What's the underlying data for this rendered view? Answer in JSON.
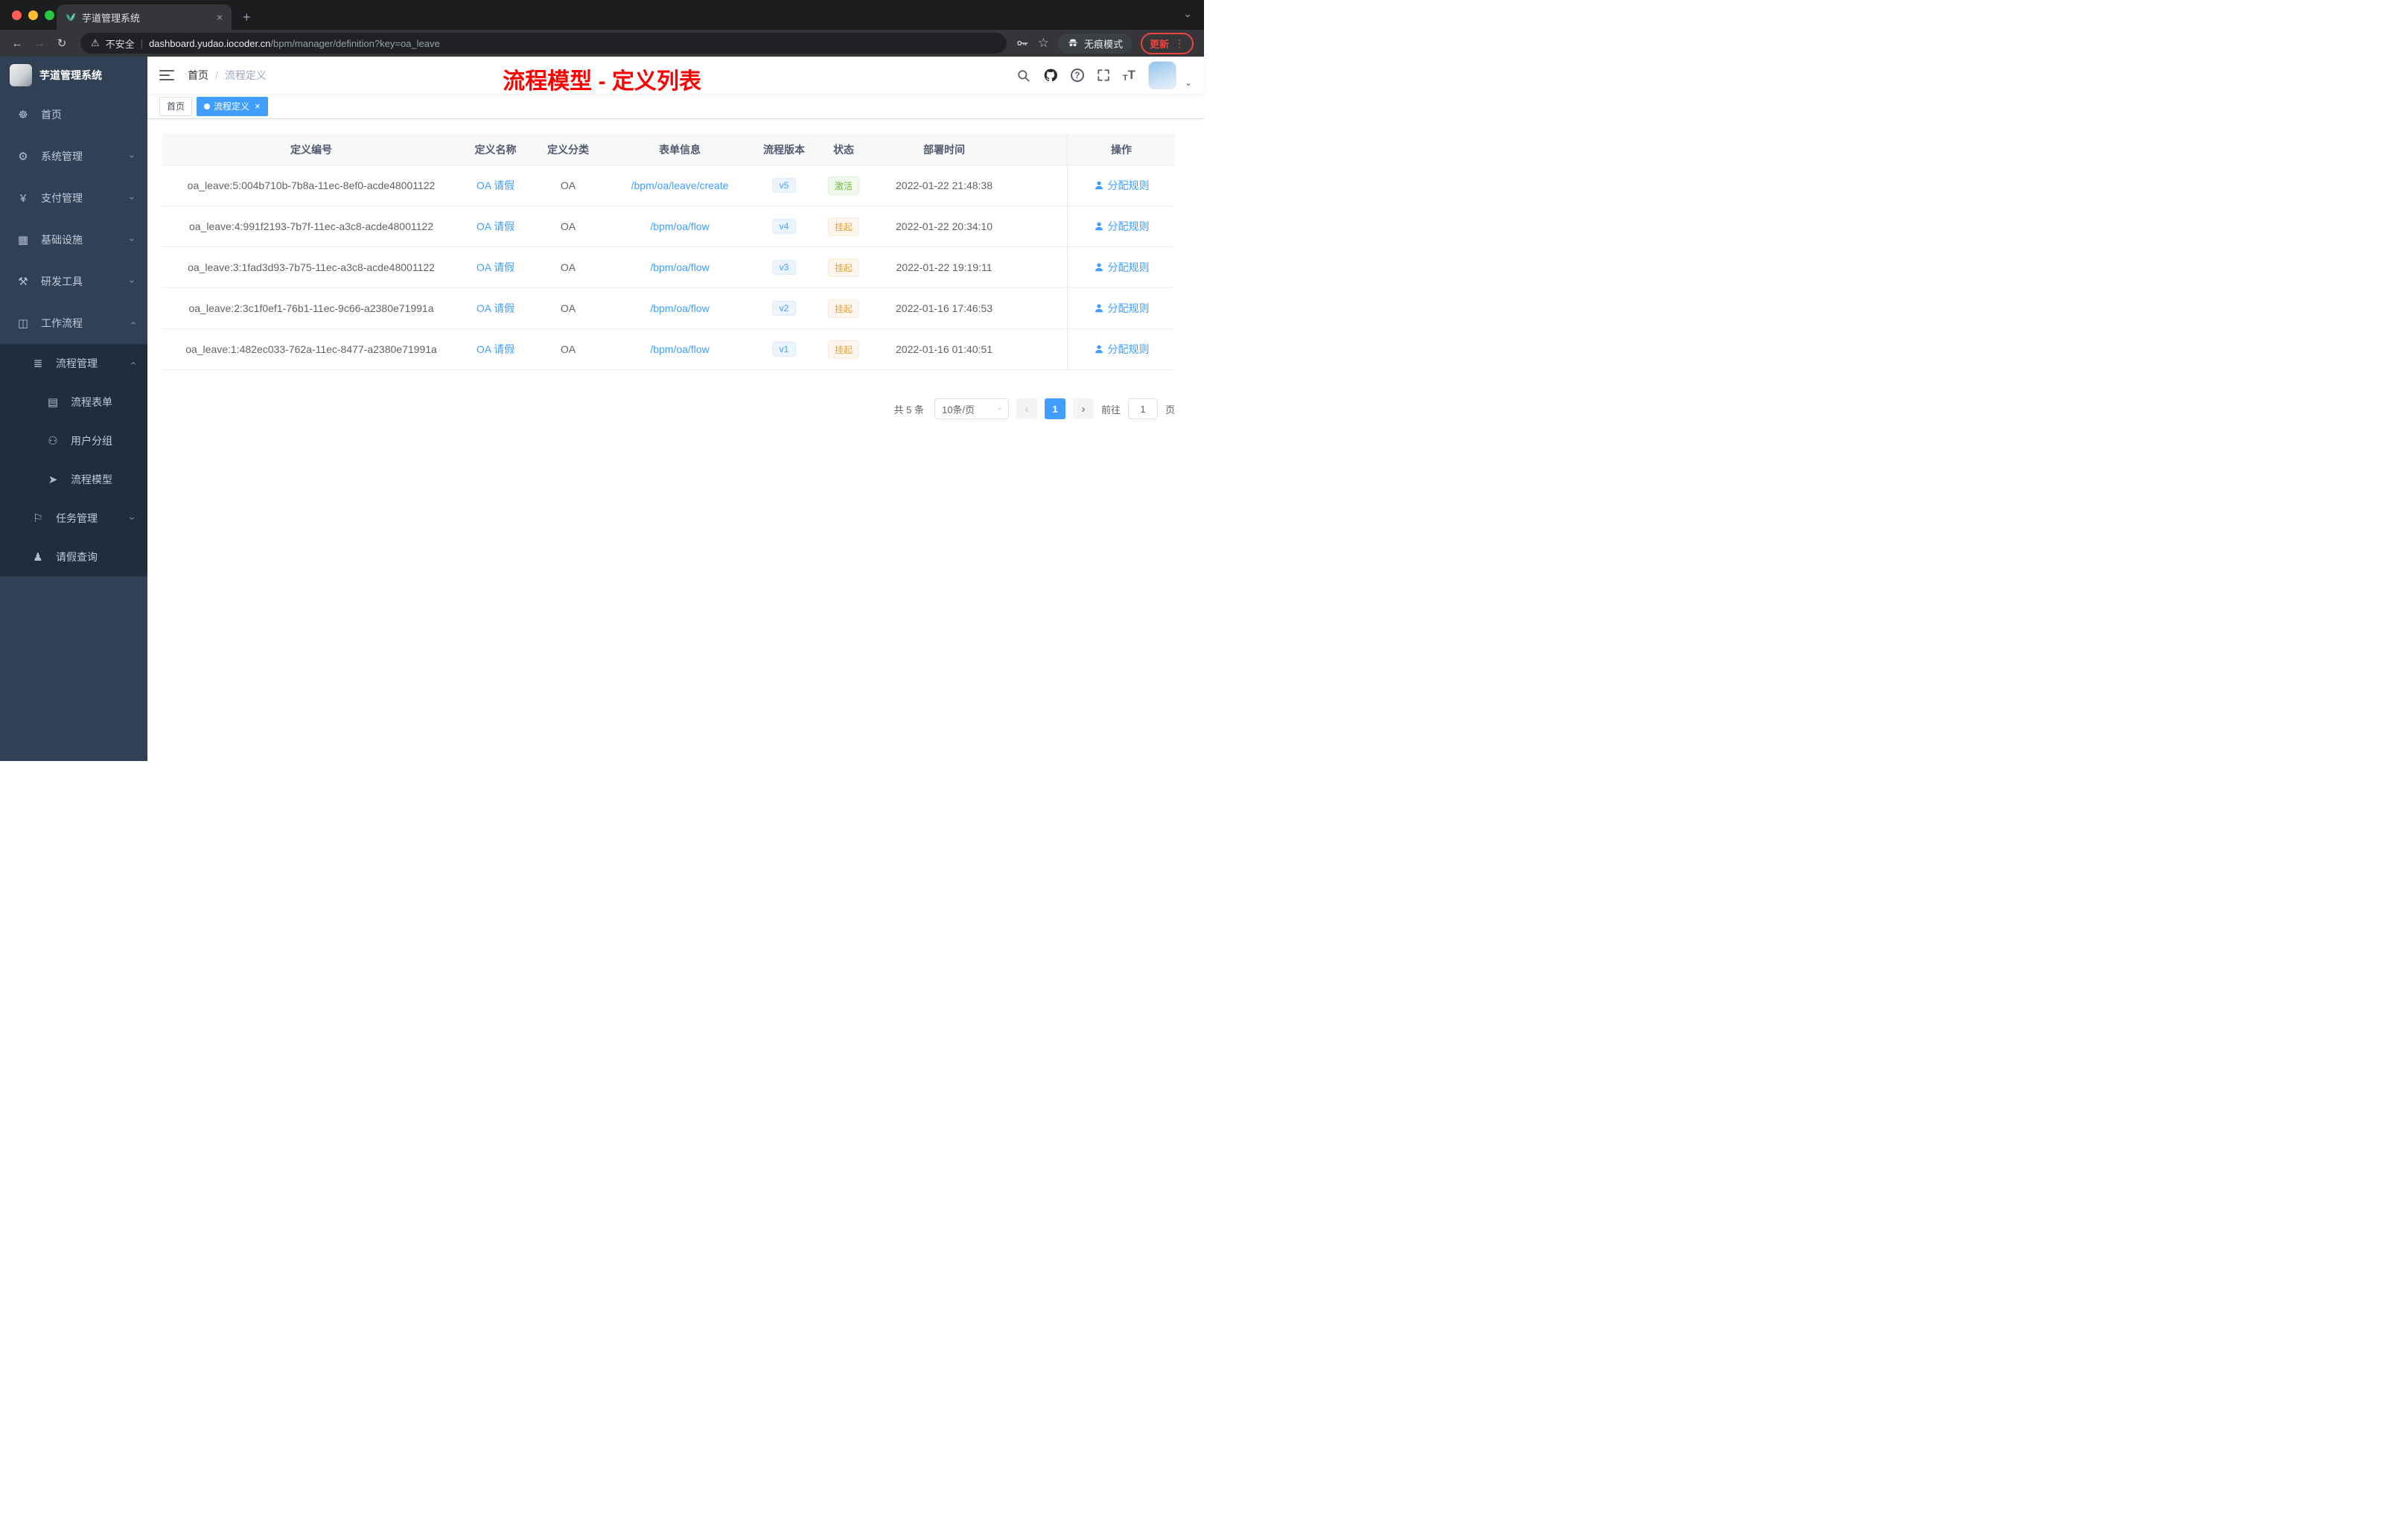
{
  "icons": {
    "close": "×",
    "plus": "+",
    "caret_down": "⌄",
    "back": "←",
    "forward": "→",
    "reload": "↻",
    "warning": "⚠",
    "divider": "|",
    "star": "☆",
    "more": "⋮",
    "chevron": "›",
    "question": "?",
    "prev": "‹",
    "next": "›",
    "t_small": "T",
    "t_big": "T"
  },
  "chrome": {
    "tab_title": "芋道管理系统",
    "security_label": "不安全",
    "url_domain": "dashboard.yudao.iocoder.cn",
    "url_path": "/bpm/manager/definition?key=oa_leave",
    "incognito_label": "无痕模式",
    "update_label": "更新"
  },
  "annotation": "流程模型 - 定义列表",
  "sidebar": {
    "title": "芋道管理系统",
    "menu": [
      {
        "label": "首页",
        "icon": "☸"
      },
      {
        "label": "系统管理",
        "icon": "⚙"
      },
      {
        "label": "支付管理",
        "icon": "¥"
      },
      {
        "label": "基础设施",
        "icon": "▦"
      },
      {
        "label": "研发工具",
        "icon": "⚒"
      },
      {
        "label": "工作流程",
        "icon": "◫"
      }
    ],
    "submenu": [
      {
        "label": "流程管理",
        "icon": "≣"
      },
      {
        "label": "流程表单",
        "icon": "▤"
      },
      {
        "label": "用户分组",
        "icon": "⚇"
      },
      {
        "label": "流程模型",
        "icon": "➤"
      },
      {
        "label": "任务管理",
        "icon": "⚐"
      },
      {
        "label": "请假查询",
        "icon": "♟"
      }
    ]
  },
  "breadcrumb": {
    "home": "首页",
    "sep": "/",
    "current": "流程定义"
  },
  "tags": [
    {
      "label": "首页"
    },
    {
      "label": "流程定义"
    }
  ],
  "table": {
    "columns": [
      "定义编号",
      "定义名称",
      "定义分类",
      "表单信息",
      "流程版本",
      "状态",
      "部署时间",
      "操作"
    ],
    "rows": [
      {
        "id": "oa_leave:5:004b710b-7b8a-11ec-8ef0-acde48001122",
        "name": "OA 请假",
        "category": "OA",
        "form": "/bpm/oa/leave/create",
        "version": "v5",
        "status": "激活",
        "time": "2022-01-22 21:48:38",
        "action": "分配规则"
      },
      {
        "id": "oa_leave:4:991f2193-7b7f-11ec-a3c8-acde48001122",
        "name": "OA 请假",
        "category": "OA",
        "form": "/bpm/oa/flow",
        "version": "v4",
        "status": "挂起",
        "time": "2022-01-22 20:34:10",
        "action": "分配规则"
      },
      {
        "id": "oa_leave:3:1fad3d93-7b75-11ec-a3c8-acde48001122",
        "name": "OA 请假",
        "category": "OA",
        "form": "/bpm/oa/flow",
        "version": "v3",
        "status": "挂起",
        "time": "2022-01-22 19:19:11",
        "action": "分配规则"
      },
      {
        "id": "oa_leave:2:3c1f0ef1-76b1-11ec-9c66-a2380e71991a",
        "name": "OA 请假",
        "category": "OA",
        "form": "/bpm/oa/flow",
        "version": "v2",
        "status": "挂起",
        "time": "2022-01-16 17:46:53",
        "action": "分配规则"
      },
      {
        "id": "oa_leave:1:482ec033-762a-11ec-8477-a2380e71991a",
        "name": "OA 请假",
        "category": "OA",
        "form": "/bpm/oa/flow",
        "version": "v1",
        "status": "挂起",
        "time": "2022-01-16 01:40:51",
        "action": "分配规则"
      }
    ]
  },
  "pagination": {
    "total": "共 5 条",
    "page_size": "10条/页",
    "current_page": "1",
    "goto_label": "前往",
    "goto_value": "1",
    "page_unit": "页"
  },
  "colors": {
    "accent": "#409eff",
    "success": "#67c23a",
    "warning": "#e6a23c",
    "annotation": "#ff0000"
  }
}
